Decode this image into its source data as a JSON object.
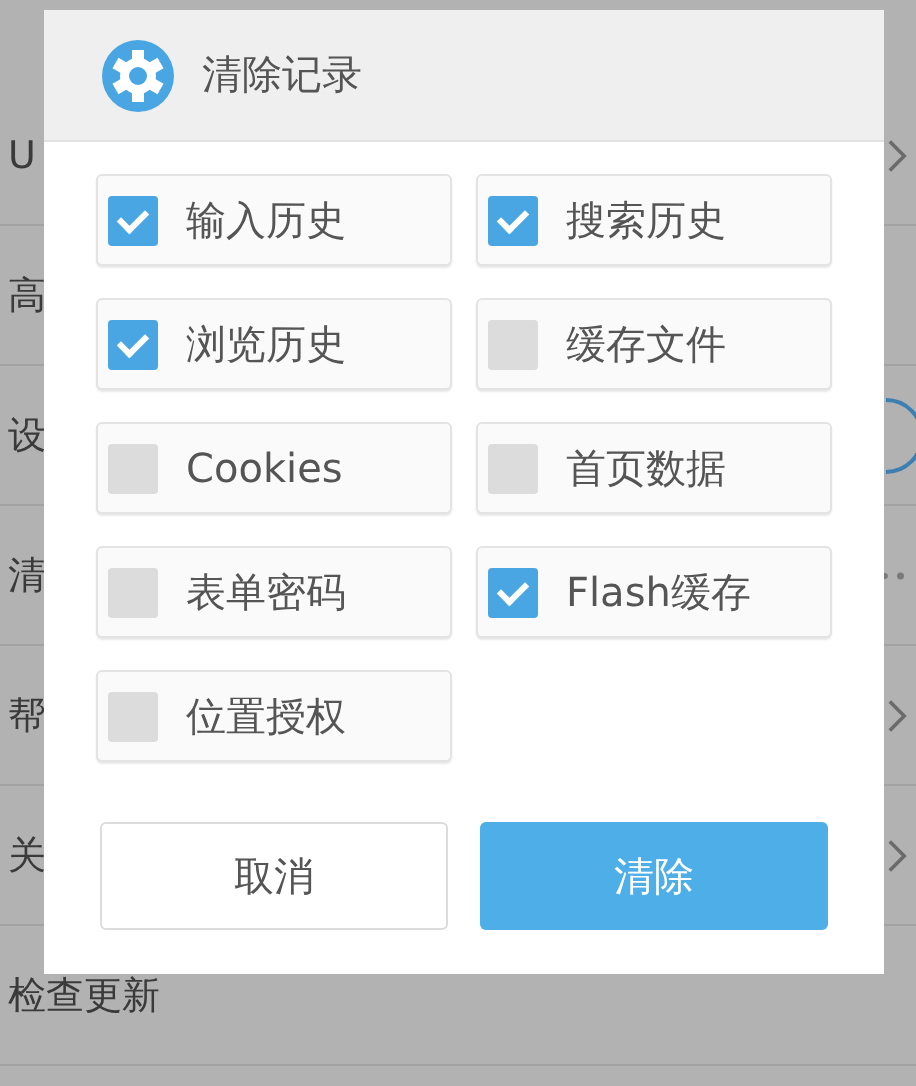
{
  "settings_list": [
    {
      "label": "U",
      "kind": "chevron"
    },
    {
      "label": "高",
      "kind": "plain"
    },
    {
      "label": "设",
      "kind": "toggle"
    },
    {
      "label": "清",
      "kind": "dots"
    },
    {
      "label": "帮",
      "kind": "chevron"
    },
    {
      "label": "关",
      "kind": "chevron"
    },
    {
      "label": "检查更新",
      "kind": "plain"
    }
  ],
  "dialog": {
    "title": "清除记录",
    "options": [
      {
        "label": "输入历史",
        "checked": true
      },
      {
        "label": "搜索历史",
        "checked": true
      },
      {
        "label": "浏览历史",
        "checked": true
      },
      {
        "label": "缓存文件",
        "checked": false
      },
      {
        "label": "Cookies",
        "checked": false
      },
      {
        "label": "首页数据",
        "checked": false
      },
      {
        "label": "表单密码",
        "checked": false
      },
      {
        "label": "Flash缓存",
        "checked": true
      },
      {
        "label": "位置授权",
        "checked": false
      }
    ],
    "buttons": [
      {
        "label": "取消",
        "kind": "secondary"
      },
      {
        "label": "清除",
        "kind": "primary"
      }
    ]
  }
}
